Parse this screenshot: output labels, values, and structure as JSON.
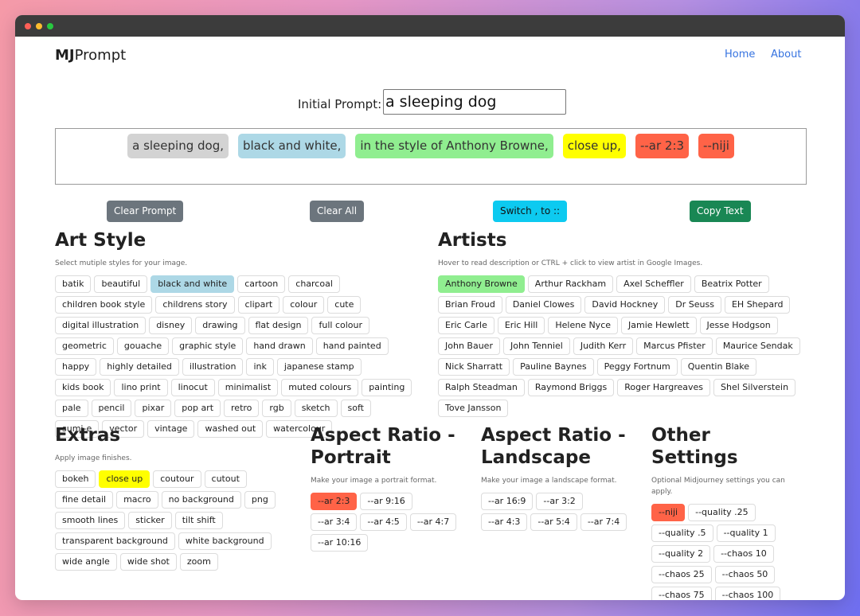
{
  "brand": {
    "bold": "MJ",
    "rest": "Prompt"
  },
  "nav": {
    "home": "Home",
    "about": "About"
  },
  "prompt": {
    "label": "Initial Prompt:",
    "value": "a sleeping dog"
  },
  "prompt_chips": [
    {
      "text": "a sleeping dog,",
      "color": "#d3d3d3"
    },
    {
      "text": "black and white,",
      "color": "#add8e6"
    },
    {
      "text": "in the style of Anthony Browne,",
      "color": "#90ee90"
    },
    {
      "text": "close up,",
      "color": "#ffff00"
    },
    {
      "text": "--ar 2:3",
      "color": "#ff6347"
    },
    {
      "text": "--niji",
      "color": "#ff6347"
    }
  ],
  "buttons": {
    "clear_prompt": "Clear Prompt",
    "clear_all": "Clear All",
    "switch": "Switch , to ::",
    "copy": "Copy Text"
  },
  "art_style": {
    "title": "Art Style",
    "desc": "Select mutiple styles for your image.",
    "tags": [
      "batik",
      "beautiful",
      "black and white",
      "cartoon",
      "charcoal",
      "children book style",
      "childrens story",
      "clipart",
      "colour",
      "cute",
      "digital illustration",
      "disney",
      "drawing",
      "flat design",
      "full colour",
      "geometric",
      "gouache",
      "graphic style",
      "hand drawn",
      "hand painted",
      "happy",
      "highly detailed",
      "illustration",
      "ink",
      "japanese stamp",
      "kids book",
      "lino print",
      "linocut",
      "minimalist",
      "muted colours",
      "painting",
      "pale",
      "pencil",
      "pixar",
      "pop art",
      "retro",
      "rgb",
      "sketch",
      "soft",
      "sumi-e",
      "vector",
      "vintage",
      "washed out",
      "watercolour"
    ],
    "selected": {
      "black and white": "blue"
    }
  },
  "artists": {
    "title": "Artists",
    "desc": "Hover to read description or CTRL + click to view artist in Google Images.",
    "tags": [
      "Anthony Browne",
      "Arthur Rackham",
      "Axel Scheffler",
      "Beatrix Potter",
      "Brian Froud",
      "Daniel Clowes",
      "David Hockney",
      "Dr Seuss",
      "EH Shepard",
      "Eric Carle",
      "Eric Hill",
      "Helene Nyce",
      "Jamie Hewlett",
      "Jesse Hodgson",
      "John Bauer",
      "John Tenniel",
      "Judith Kerr",
      "Marcus Pfister",
      "Maurice Sendak",
      "Nick Sharratt",
      "Pauline Baynes",
      "Peggy Fortnum",
      "Quentin Blake",
      "Ralph Steadman",
      "Raymond Briggs",
      "Roger Hargreaves",
      "Shel Silverstein",
      "Tove Jansson"
    ],
    "selected": {
      "Anthony Browne": "green"
    }
  },
  "extras": {
    "title": "Extras",
    "desc": "Apply image finishes.",
    "tags": [
      "bokeh",
      "close up",
      "coutour",
      "cutout",
      "fine detail",
      "macro",
      "no background",
      "png",
      "smooth lines",
      "sticker",
      "tilt shift",
      "transparent background",
      "white background",
      "wide angle",
      "wide shot",
      "zoom"
    ],
    "selected": {
      "close up": "yellow"
    }
  },
  "portrait": {
    "title": "Aspect Ratio - Portrait",
    "desc": "Make your image a portrait format.",
    "tags": [
      "--ar 2:3",
      "--ar 9:16",
      "--ar 3:4",
      "--ar 4:5",
      "--ar 4:7",
      "--ar 10:16"
    ],
    "selected": {
      "--ar 2:3": "red"
    }
  },
  "landscape": {
    "title": "Aspect Ratio - Landscape",
    "desc": "Make your image a landscape format.",
    "tags": [
      "--ar 16:9",
      "--ar 3:2",
      "--ar 4:3",
      "--ar 5:4",
      "--ar 7:4"
    ],
    "selected": {}
  },
  "other": {
    "title": "Other Settings",
    "desc": "Optional Midjourney settings you can apply.",
    "tags": [
      "--niji",
      "--quality .25",
      "--quality .5",
      "--quality 1",
      "--quality 2",
      "--chaos 10",
      "--chaos 25",
      "--chaos 50",
      "--chaos 75",
      "--chaos 100"
    ],
    "selected": {
      "--niji": "red"
    }
  },
  "colors": {
    "clear_prompt_bg": "#6c757d",
    "clear_all_bg": "#6c757d",
    "switch_bg": "#0dcaf0",
    "copy_bg": "#198754",
    "link": "#3673e0"
  }
}
